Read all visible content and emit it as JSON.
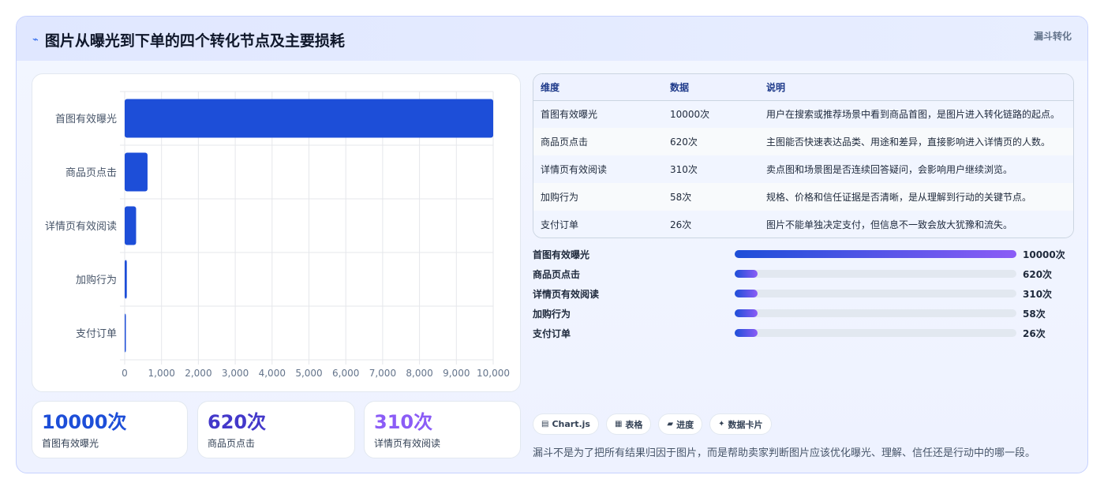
{
  "header": {
    "title": "图片从曝光到下单的四个转化节点及主要损耗",
    "title_icon": "⌁",
    "tag": "漏斗转化"
  },
  "chart_data": {
    "type": "bar",
    "orientation": "horizontal",
    "categories": [
      "首图有效曝光",
      "商品页点击",
      "详情页有效阅读",
      "加购行为",
      "支付订单"
    ],
    "values": [
      10000,
      620,
      310,
      58,
      26
    ],
    "xlim": [
      0,
      10000
    ],
    "x_ticks": [
      "0",
      "1,000",
      "2,000",
      "3,000",
      "4,000",
      "5,000",
      "6,000",
      "7,000",
      "8,000",
      "9,000",
      "10,000"
    ],
    "bar_color": "#1d4ed8",
    "grid": true,
    "title": "",
    "xlabel": "",
    "ylabel": ""
  },
  "stats": [
    {
      "value": "10000次",
      "label": "首图有效曝光",
      "color": "#1d4ed8"
    },
    {
      "value": "620次",
      "label": "商品页点击",
      "color": "#4338ca"
    },
    {
      "value": "310次",
      "label": "详情页有效阅读",
      "color": "#8b5cf6"
    }
  ],
  "table": {
    "headers": [
      "维度",
      "数据",
      "说明"
    ],
    "rows": [
      [
        "首图有效曝光",
        "10000次",
        "用户在搜索或推荐场景中看到商品首图，是图片进入转化链路的起点。"
      ],
      [
        "商品页点击",
        "620次",
        "主图能否快速表达品类、用途和差异，直接影响进入详情页的人数。"
      ],
      [
        "详情页有效阅读",
        "310次",
        "卖点图和场景图是否连续回答疑问，会影响用户继续浏览。"
      ],
      [
        "加购行为",
        "58次",
        "规格、价格和信任证据是否清晰，是从理解到行动的关键节点。"
      ],
      [
        "支付订单",
        "26次",
        "图片不能单独决定支付，但信息不一致会放大犹豫和流失。"
      ]
    ]
  },
  "progress": [
    {
      "label": "首图有效曝光",
      "value": "10000次",
      "fraction": 1.0
    },
    {
      "label": "商品页点击",
      "value": "620次",
      "fraction": 0.08
    },
    {
      "label": "详情页有效阅读",
      "value": "310次",
      "fraction": 0.08
    },
    {
      "label": "加购行为",
      "value": "58次",
      "fraction": 0.08
    },
    {
      "label": "支付订单",
      "value": "26次",
      "fraction": 0.08
    }
  ],
  "chips": [
    {
      "icon": "▤",
      "label": "Chart.js"
    },
    {
      "icon": "▦",
      "label": "表格"
    },
    {
      "icon": "▰",
      "label": "进度"
    },
    {
      "icon": "✦",
      "label": "数据卡片"
    }
  ],
  "note": "漏斗不是为了把所有结果归因于图片，而是帮助卖家判断图片应该优化曝光、理解、信任还是行动中的哪一段。"
}
